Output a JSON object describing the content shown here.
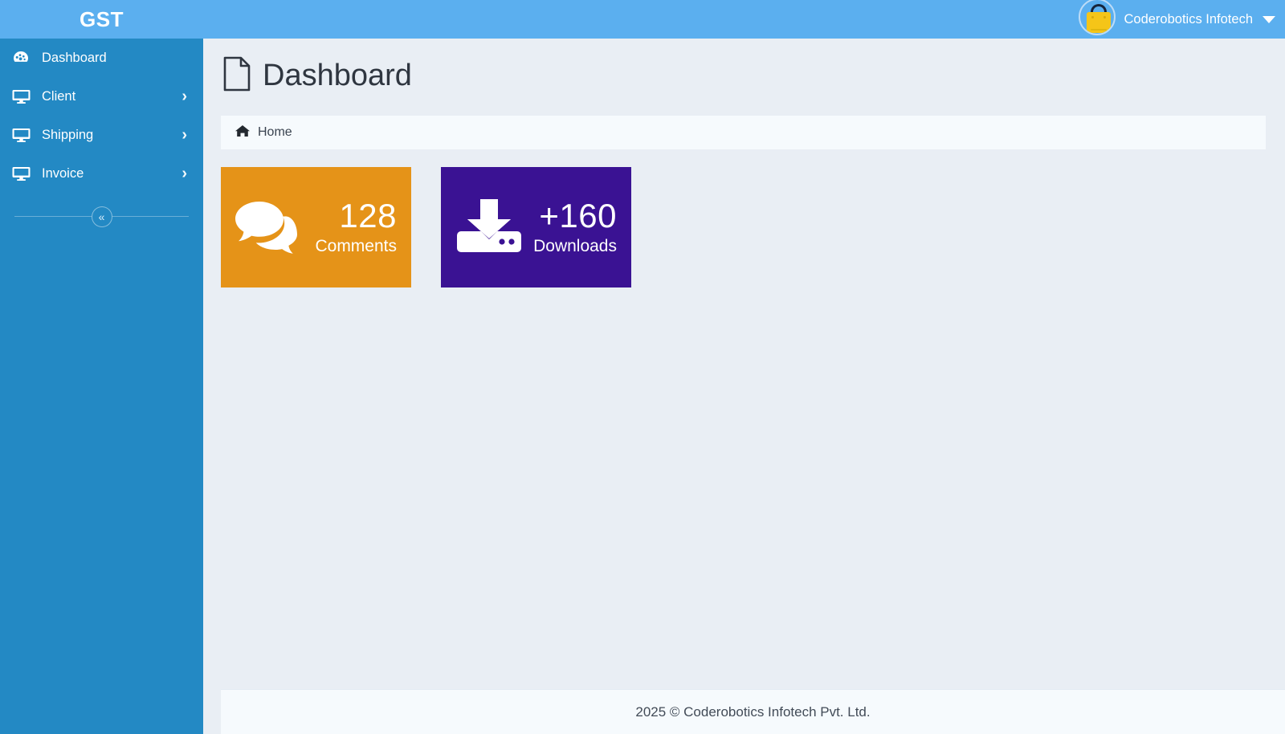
{
  "header": {
    "brand": "GST",
    "user_name": "Coderobotics Infotech",
    "avatar_icon": "shopping-bag-icon",
    "caret_icon": "caret-down-icon"
  },
  "sidebar": {
    "items": [
      {
        "label": "Dashboard",
        "icon": "tachometer-icon",
        "has_arrow": false,
        "arrow": ""
      },
      {
        "label": "Client",
        "icon": "desktop-icon",
        "has_arrow": true,
        "arrow": "›"
      },
      {
        "label": "Shipping",
        "icon": "desktop-icon",
        "has_arrow": true,
        "arrow": "›"
      },
      {
        "label": "Invoice",
        "icon": "desktop-icon",
        "has_arrow": true,
        "arrow": "›"
      }
    ],
    "collapse_label": "«",
    "collapse_icon": "double-chevron-left-icon"
  },
  "main": {
    "page_title": "Dashboard",
    "page_title_icon": "file-icon",
    "breadcrumb": {
      "home_icon": "home-icon",
      "home_label": "Home"
    },
    "cards": [
      {
        "value": "128",
        "label": "Comments",
        "color": "#e59318",
        "icon": "comments-icon"
      },
      {
        "value": "+160",
        "label": "Downloads",
        "color": "#3a1293",
        "icon": "download-icon"
      }
    ]
  },
  "footer": {
    "text": "2025 © Coderobotics Infotech Pvt. Ltd."
  },
  "colors": {
    "header_blue": "#5bafef",
    "sidebar_blue": "#2389c4",
    "content_bg": "#e9eef4",
    "panel_bg": "#f6fafd",
    "orange": "#e59318",
    "purple": "#3a1293"
  }
}
